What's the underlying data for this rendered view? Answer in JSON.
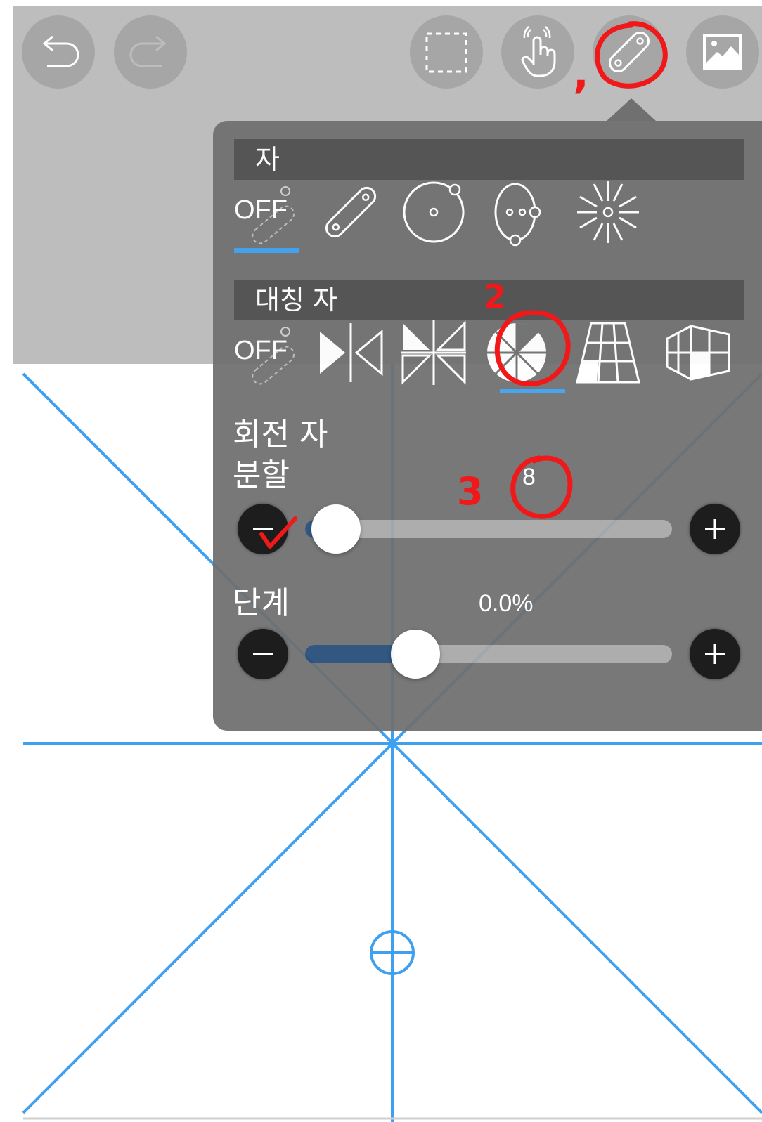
{
  "toolbar": {
    "buttons": [
      {
        "icon": "undo-icon"
      },
      {
        "icon": "redo-icon"
      },
      {
        "icon": "selection-icon"
      },
      {
        "icon": "hand-touch-icon"
      },
      {
        "icon": "ruler-icon",
        "active": true
      },
      {
        "icon": "image-icon"
      }
    ]
  },
  "panel": {
    "ruler_section": {
      "title": "자",
      "off_label": "OFF",
      "options": [
        "off",
        "straight-ruler",
        "ellipse-ruler",
        "curve-ruler",
        "radial-ruler"
      ],
      "selected": "off"
    },
    "symmetry_section": {
      "title": "대칭 자",
      "off_label": "OFF",
      "options": [
        "off",
        "mirror",
        "kaleidoscope",
        "rotational",
        "perspective",
        "3d-perspective"
      ],
      "selected": "rotational"
    },
    "rotation": {
      "title": "회전 자",
      "division_label": "분할",
      "division_value": "8",
      "division_fraction": 0.0,
      "step_label": "단계",
      "step_value": "0.0%",
      "step_fraction": 0.26
    }
  },
  "annotations": {
    "mark_1": ",",
    "mark_2": "2",
    "mark_3": "3",
    "mark_4": "✓"
  },
  "colors": {
    "guide_line": "#3fa0f0",
    "annotation": "#f01818",
    "selected_underline": "#3fa0f0"
  }
}
